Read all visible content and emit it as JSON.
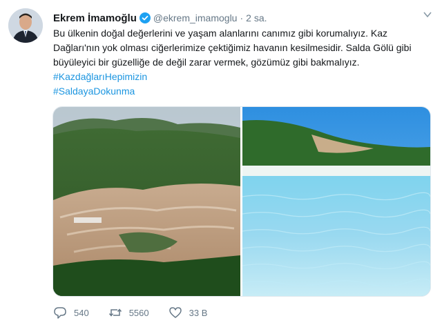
{
  "author": {
    "name": "Ekrem İmamoğlu",
    "handle": "@ekrem_imamoglu",
    "separator": "·",
    "time": "2 sa."
  },
  "tweet": {
    "text": "Bu ülkenin doğal değerlerini ve yaşam alanlarını canımız gibi korumalıyız. Kaz Dağları'nın yok olması ciğerlerimize çektiğimiz havanın kesilmesidir. Salda Gölü gibi büyüleyici bir güzelliğe de değil zarar vermek, gözümüz gibi bakmalıyız.",
    "hashtags": [
      "#KazdağlarıHepimizin",
      "#SaldayaDokunma"
    ]
  },
  "actions": {
    "replies": "540",
    "retweets": "5560",
    "likes": "33 B"
  },
  "colors": {
    "link": "#1b95e0",
    "verified": "#1da1f2",
    "muted": "#657786"
  },
  "icons": [
    "verified-badge-icon",
    "caret-down-icon",
    "reply-icon",
    "retweet-icon",
    "like-icon"
  ]
}
